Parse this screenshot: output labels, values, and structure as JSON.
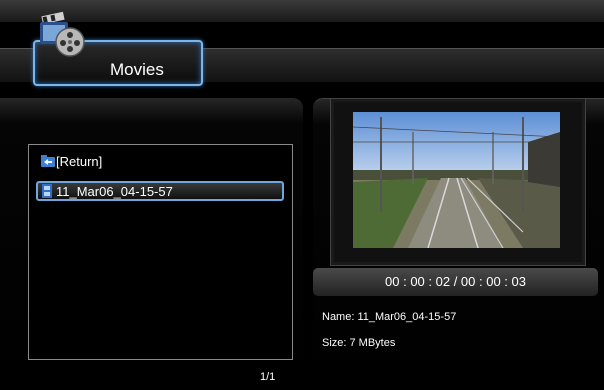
{
  "header": {
    "title": "Movies",
    "icon": "film-reel-icon"
  },
  "browser": {
    "items": [
      {
        "label": "[Return]",
        "icon": "return-folder-icon"
      },
      {
        "label": "11_Mar06_04-15-57",
        "icon": "film-file-icon",
        "selected": true
      }
    ],
    "page_indicator": "1/1"
  },
  "preview": {
    "time": "00 : 00 : 02 / 00 : 00 : 03",
    "name": "Name: 11_Mar06_04-15-57",
    "size": "Size: 7 MBytes"
  },
  "colors": {
    "highlight_border": "#6fa6dd",
    "background": "#000000"
  }
}
